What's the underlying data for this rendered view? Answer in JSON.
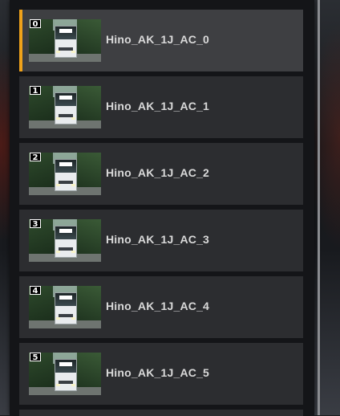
{
  "list": {
    "items": [
      {
        "index": "0",
        "label": "Hino_AK_1J_AC_0",
        "selected": true
      },
      {
        "index": "1",
        "label": "Hino_AK_1J_AC_1",
        "selected": false
      },
      {
        "index": "2",
        "label": "Hino_AK_1J_AC_2",
        "selected": false
      },
      {
        "index": "3",
        "label": "Hino_AK_1J_AC_3",
        "selected": false
      },
      {
        "index": "4",
        "label": "Hino_AK_1J_AC_4",
        "selected": false
      },
      {
        "index": "5",
        "label": "Hino_AK_1J_AC_5",
        "selected": false
      }
    ]
  },
  "colors": {
    "accent": "#f0a21a",
    "item_bg": "#2c2d30",
    "item_selected_bg": "#3e3f42",
    "label_text": "#d9d9d9"
  },
  "icons": {
    "thumbnail": "bus-thumbnail-icon"
  }
}
